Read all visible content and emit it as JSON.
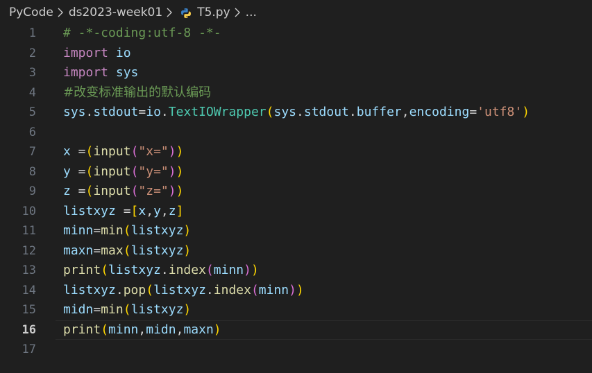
{
  "breadcrumb": {
    "items": [
      "PyCode",
      "ds2023-week01",
      "T5.py",
      "..."
    ],
    "separator_icon": "chevron-right-icon",
    "file_icon": "python-icon"
  },
  "colors": {
    "background": "#1f1f1f",
    "comment": "#6a9955",
    "keyword": "#c586c0",
    "identifier": "#9cdcfe",
    "function": "#dcdcaa",
    "class": "#4ec9b0",
    "string": "#ce9178",
    "bracket_level_1": "#ffd700",
    "bracket_level_2": "#da70d6",
    "bracket_level_3": "#179fff",
    "line_number": "#6e7681",
    "line_number_active": "#cccccc"
  },
  "editor": {
    "active_line": 16,
    "lines": [
      {
        "num": "1",
        "tokens": [
          {
            "t": "# -*-coding:utf-8 -*-",
            "c": "comment"
          }
        ]
      },
      {
        "num": "2",
        "tokens": [
          {
            "t": "import",
            "c": "keyword"
          },
          {
            "t": " ",
            "c": "plain"
          },
          {
            "t": "io",
            "c": "ident"
          }
        ]
      },
      {
        "num": "3",
        "tokens": [
          {
            "t": "import",
            "c": "keyword"
          },
          {
            "t": " ",
            "c": "plain"
          },
          {
            "t": "sys",
            "c": "ident"
          }
        ]
      },
      {
        "num": "4",
        "tokens": [
          {
            "t": "#改变标准输出的默认编码",
            "c": "comment cjk"
          }
        ]
      },
      {
        "num": "5",
        "tokens": [
          {
            "t": "sys",
            "c": "ident"
          },
          {
            "t": ".",
            "c": "plain"
          },
          {
            "t": "stdout",
            "c": "ident"
          },
          {
            "t": "=",
            "c": "plain"
          },
          {
            "t": "io",
            "c": "ident"
          },
          {
            "t": ".",
            "c": "plain"
          },
          {
            "t": "TextIOWrapper",
            "c": "class"
          },
          {
            "t": "(",
            "c": "b1"
          },
          {
            "t": "sys",
            "c": "ident"
          },
          {
            "t": ".",
            "c": "plain"
          },
          {
            "t": "stdout",
            "c": "ident"
          },
          {
            "t": ".",
            "c": "plain"
          },
          {
            "t": "buffer",
            "c": "ident"
          },
          {
            "t": ",",
            "c": "plain"
          },
          {
            "t": "encoding",
            "c": "param"
          },
          {
            "t": "=",
            "c": "plain"
          },
          {
            "t": "'utf8'",
            "c": "string"
          },
          {
            "t": ")",
            "c": "b1"
          }
        ]
      },
      {
        "num": "6",
        "tokens": []
      },
      {
        "num": "7",
        "tokens": [
          {
            "t": "x",
            "c": "ident"
          },
          {
            "t": " =",
            "c": "plain"
          },
          {
            "t": "(",
            "c": "b1"
          },
          {
            "t": "input",
            "c": "func"
          },
          {
            "t": "(",
            "c": "b2"
          },
          {
            "t": "\"x=\"",
            "c": "string"
          },
          {
            "t": ")",
            "c": "b2"
          },
          {
            "t": ")",
            "c": "b1"
          }
        ]
      },
      {
        "num": "8",
        "tokens": [
          {
            "t": "y",
            "c": "ident"
          },
          {
            "t": " =",
            "c": "plain"
          },
          {
            "t": "(",
            "c": "b1"
          },
          {
            "t": "input",
            "c": "func"
          },
          {
            "t": "(",
            "c": "b2"
          },
          {
            "t": "\"y=\"",
            "c": "string"
          },
          {
            "t": ")",
            "c": "b2"
          },
          {
            "t": ")",
            "c": "b1"
          }
        ]
      },
      {
        "num": "9",
        "tokens": [
          {
            "t": "z",
            "c": "ident"
          },
          {
            "t": " =",
            "c": "plain"
          },
          {
            "t": "(",
            "c": "b1"
          },
          {
            "t": "input",
            "c": "func"
          },
          {
            "t": "(",
            "c": "b2"
          },
          {
            "t": "\"z=\"",
            "c": "string"
          },
          {
            "t": ")",
            "c": "b2"
          },
          {
            "t": ")",
            "c": "b1"
          }
        ]
      },
      {
        "num": "10",
        "tokens": [
          {
            "t": "listxyz",
            "c": "ident"
          },
          {
            "t": " =",
            "c": "plain"
          },
          {
            "t": "[",
            "c": "b1"
          },
          {
            "t": "x",
            "c": "ident"
          },
          {
            "t": ",",
            "c": "plain"
          },
          {
            "t": "y",
            "c": "ident"
          },
          {
            "t": ",",
            "c": "plain"
          },
          {
            "t": "z",
            "c": "ident"
          },
          {
            "t": "]",
            "c": "b1"
          }
        ]
      },
      {
        "num": "11",
        "tokens": [
          {
            "t": "minn",
            "c": "ident"
          },
          {
            "t": "=",
            "c": "plain"
          },
          {
            "t": "min",
            "c": "func"
          },
          {
            "t": "(",
            "c": "b1"
          },
          {
            "t": "listxyz",
            "c": "ident"
          },
          {
            "t": ")",
            "c": "b1"
          }
        ]
      },
      {
        "num": "12",
        "tokens": [
          {
            "t": "maxn",
            "c": "ident"
          },
          {
            "t": "=",
            "c": "plain"
          },
          {
            "t": "max",
            "c": "func"
          },
          {
            "t": "(",
            "c": "b1"
          },
          {
            "t": "listxyz",
            "c": "ident"
          },
          {
            "t": ")",
            "c": "b1"
          }
        ]
      },
      {
        "num": "13",
        "tokens": [
          {
            "t": "print",
            "c": "func"
          },
          {
            "t": "(",
            "c": "b1"
          },
          {
            "t": "listxyz",
            "c": "ident"
          },
          {
            "t": ".",
            "c": "plain"
          },
          {
            "t": "index",
            "c": "func"
          },
          {
            "t": "(",
            "c": "b2"
          },
          {
            "t": "minn",
            "c": "ident"
          },
          {
            "t": ")",
            "c": "b2"
          },
          {
            "t": ")",
            "c": "b1"
          }
        ]
      },
      {
        "num": "14",
        "tokens": [
          {
            "t": "listxyz",
            "c": "ident"
          },
          {
            "t": ".",
            "c": "plain"
          },
          {
            "t": "pop",
            "c": "func"
          },
          {
            "t": "(",
            "c": "b1"
          },
          {
            "t": "listxyz",
            "c": "ident"
          },
          {
            "t": ".",
            "c": "plain"
          },
          {
            "t": "index",
            "c": "func"
          },
          {
            "t": "(",
            "c": "b2"
          },
          {
            "t": "minn",
            "c": "ident"
          },
          {
            "t": ")",
            "c": "b2"
          },
          {
            "t": ")",
            "c": "b1"
          }
        ]
      },
      {
        "num": "15",
        "tokens": [
          {
            "t": "midn",
            "c": "ident"
          },
          {
            "t": "=",
            "c": "plain"
          },
          {
            "t": "min",
            "c": "func"
          },
          {
            "t": "(",
            "c": "b1"
          },
          {
            "t": "listxyz",
            "c": "ident"
          },
          {
            "t": ")",
            "c": "b1"
          }
        ]
      },
      {
        "num": "16",
        "tokens": [
          {
            "t": "print",
            "c": "func"
          },
          {
            "t": "(",
            "c": "b1"
          },
          {
            "t": "minn",
            "c": "ident"
          },
          {
            "t": ",",
            "c": "plain"
          },
          {
            "t": "midn",
            "c": "ident"
          },
          {
            "t": ",",
            "c": "plain"
          },
          {
            "t": "maxn",
            "c": "ident"
          },
          {
            "t": ")",
            "c": "b1"
          }
        ]
      },
      {
        "num": "17",
        "tokens": []
      }
    ]
  }
}
